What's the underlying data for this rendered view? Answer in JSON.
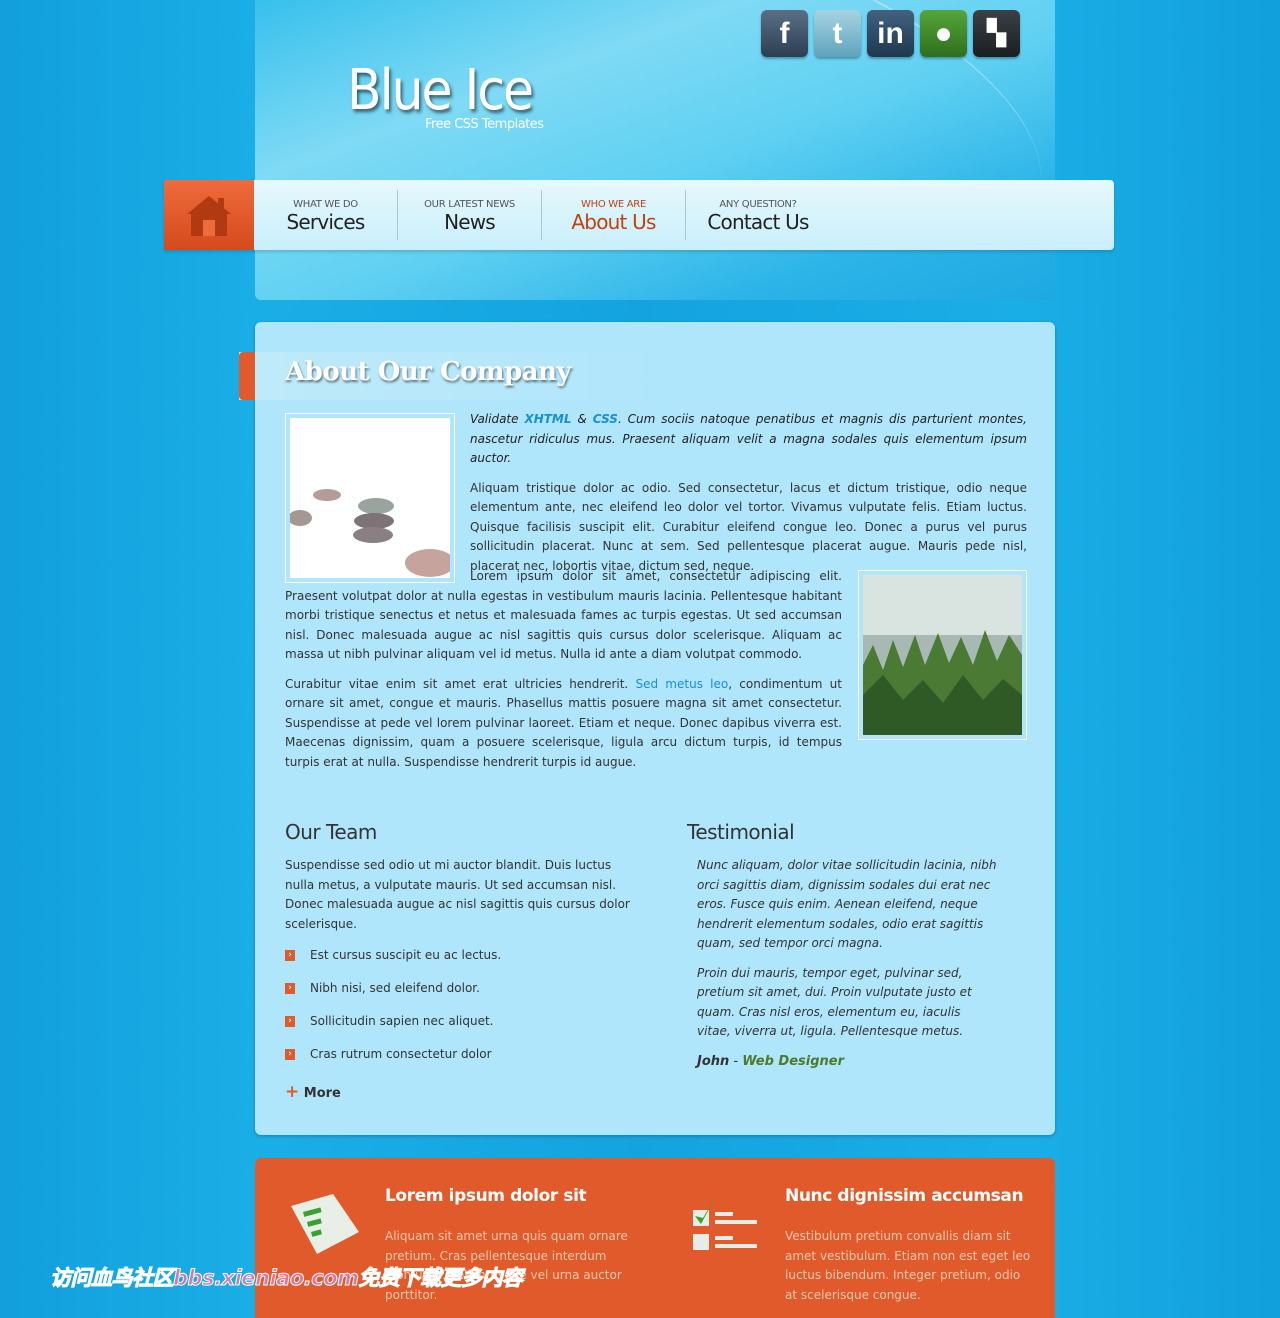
{
  "header": {
    "logo": "Blue Ice",
    "tagline": "Free CSS Templates",
    "social": [
      {
        "name": "facebook",
        "glyph": "f",
        "color": "#3b4f66"
      },
      {
        "name": "twitter",
        "glyph": "t",
        "color": "#7ab8cc"
      },
      {
        "name": "linkedin",
        "glyph": "in",
        "color": "#2d4a63"
      },
      {
        "name": "chat",
        "glyph": "●",
        "color": "#3f8a2a"
      },
      {
        "name": "myspace",
        "glyph": "▚",
        "color": "#25292d"
      }
    ]
  },
  "nav": {
    "home": "home-icon",
    "items": [
      {
        "sub": "WHAT WE DO",
        "main": "Services"
      },
      {
        "sub": "OUR LATEST NEWS",
        "main": "News"
      },
      {
        "sub": "WHO WE ARE",
        "main": "About Us",
        "active": true
      },
      {
        "sub": "ANY QUESTION?",
        "main": "Contact Us"
      }
    ]
  },
  "content": {
    "title": "About Our Company",
    "intro": {
      "pre": "Validate ",
      "xhtml": "XHTML",
      "amp": " & ",
      "css": "CSS",
      "post": ". Cum sociis natoque penatibus et magnis dis parturient montes, nascetur ridiculus mus. Praesent aliquam velit a magna sodales quis elementum ipsum auctor."
    },
    "p1": "Aliquam tristique dolor ac odio. Sed consectetur, lacus et dictum tristique, odio neque elementum ante, nec eleifend leo dolor vel tortor. Vivamus vulputate felis. Etiam luctus. Quisque facilisis suscipit elit. Curabitur eleifend congue leo. Donec a purus vel purus sollicitudin placerat. Nunc at sem. Sed pellentesque placerat augue. Mauris pede nisl, placerat nec, lobortis vitae, dictum sed, neque.",
    "p2": "Lorem ipsum dolor sit amet, consectetur adipiscing elit. Praesent volutpat dolor at nulla egestas in vestibulum mauris lacinia. Pellentesque habitant morbi tristique senectus et netus et malesuada fames ac turpis egestas. Ut sed accumsan nisl. Donec malesuada augue ac nisl sagittis quis cursus dolor scelerisque. Aliquam ac massa ut nibh pulvinar aliquam vel id metus. Nulla id ante a diam volutpat commodo.",
    "p3": {
      "pre": "Curabitur vitae enim sit amet erat ultricies hendrerit. ",
      "link": "Sed metus leo",
      "post": ", condimentum ut ornare sit amet, congue et mauris. Phasellus mattis posuere magna sit amet consectetur. Suspendisse at pede vel lorem pulvinar laoreet. Etiam et neque. Donec dapibus viverra est. Maecenas dignissim, quam a posuere scelerisque, ligula arcu dictum turpis, id tempus turpis erat at nulla. Suspendisse hendrerit turpis id augue."
    },
    "team": {
      "title": "Our Team",
      "text": "Suspendisse sed odio ut mi auctor blandit. Duis luctus nulla metus, a vulputate mauris. Ut sed accumsan nisl. Donec malesuada augue ac nisl sagittis quis cursus dolor scelerisque.",
      "items": [
        "Est cursus suscipit eu ac lectus.",
        "Nibh nisi, sed eleifend dolor.",
        "Sollicitudin sapien nec aliquet.",
        "Cras rutrum consectetur dolor"
      ],
      "more": "More"
    },
    "testimonial": {
      "title": "Testimonial",
      "p1": "Nunc aliquam, dolor vitae sollicitudin lacinia, nibh orci sagittis diam, dignissim sodales dui erat nec eros. Fusce quis enim. Aenean eleifend, neque hendrerit elementum sodales, odio erat sagittis quam, sed tempor orci magna.",
      "p2": "Proin dui mauris, tempor eget, pulvinar sed, pretium sit amet, dui. Proin vulputate justo et quam. Cras nisl eros, elementum eu, iaculis vitae, viverra ut, ligula. Pellentesque metus.",
      "author": "John",
      "sep": " - ",
      "role": "Web Designer"
    }
  },
  "footer": [
    {
      "title": "Lorem ipsum dolor sit",
      "text": "Aliquam sit amet urna quis quam ornare pretium. Cras pellentesque interdum nibh urna. Pellentesque vel urna auctor porttitor."
    },
    {
      "title": "Nunc dignissim accumsan",
      "text": "Vestibulum pretium convallis diam sit amet vestibulum. Etiam non est eget leo luctus bibendum. Integer pretium, odio at scelerisque congue."
    }
  ],
  "watermark": "访问血鸟社区bbs.xieniao.com免费下载更多内容"
}
